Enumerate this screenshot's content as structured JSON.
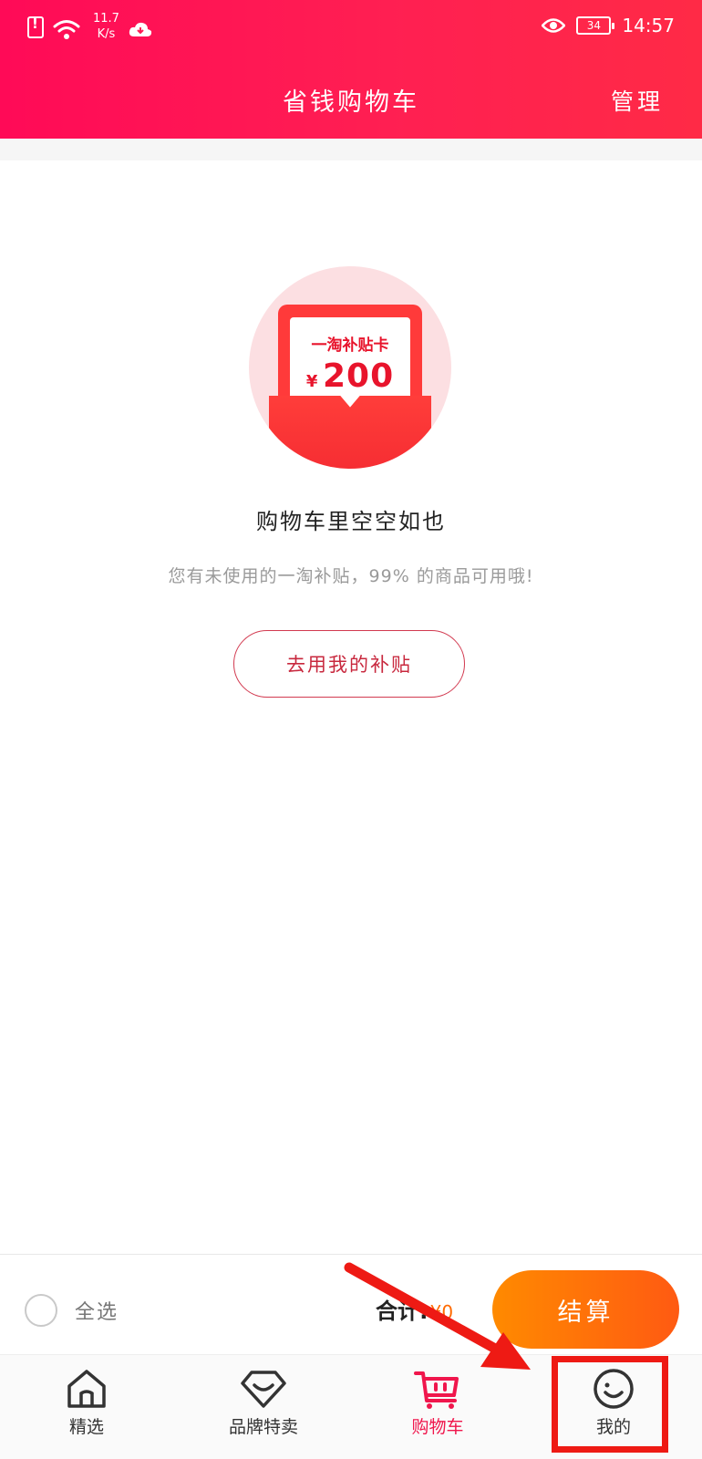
{
  "status_bar": {
    "net_speed_value": "11.7",
    "net_speed_unit": "K/s",
    "battery": "34",
    "time": "14:57",
    "icons": [
      "sim-alert-icon",
      "wifi-icon",
      "cloud-icon",
      "eye-icon",
      "battery-icon"
    ]
  },
  "header": {
    "title": "省钱购物车",
    "manage_label": "管理",
    "background_colors": [
      "#ff0a57",
      "#ff2a46"
    ]
  },
  "empty_state": {
    "card_title": "一淘补贴卡",
    "card_currency": "¥",
    "card_amount": "200",
    "title": "购物车里空空如也",
    "subtitle": "您有未使用的一淘补贴，99% 的商品可用哦!",
    "button_label": "去用我的补贴"
  },
  "checkout": {
    "select_all_label": "全选",
    "total_label": "合计:",
    "total_value": "¥0",
    "pay_label": "结算",
    "pay_colors": [
      "#ff8a00",
      "#ff5a12"
    ]
  },
  "tabbar": {
    "tabs": [
      {
        "label": "精选",
        "icon": "home-icon",
        "active": false
      },
      {
        "label": "品牌特卖",
        "icon": "diamond-icon",
        "active": false
      },
      {
        "label": "购物车",
        "icon": "cart-icon",
        "active": true
      },
      {
        "label": "我的",
        "icon": "smiley-face-icon",
        "active": false
      }
    ],
    "active_color": "#f0164c"
  },
  "annotation": {
    "arrow_color": "#ee1a14",
    "highlight_color": "#ee1a14"
  }
}
